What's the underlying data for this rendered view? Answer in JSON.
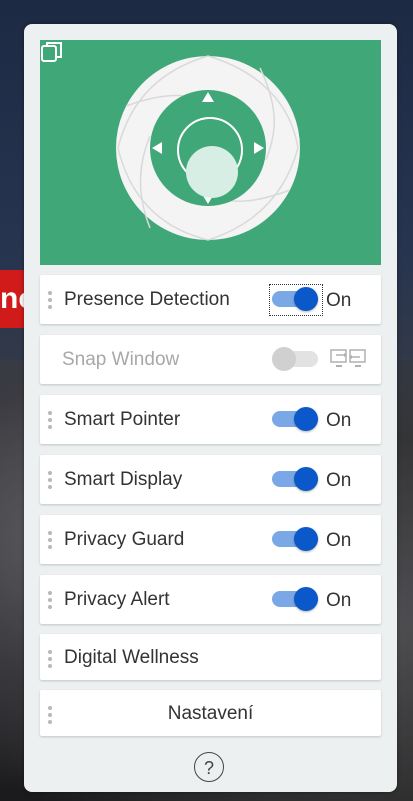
{
  "background": {
    "brand_fragment": "no"
  },
  "hero": {
    "accent_color": "#3fa778",
    "copy_icon": "copy-icon"
  },
  "items": [
    {
      "label": "Presence Detection",
      "state": "On",
      "enabled": true
    },
    {
      "label": "Snap Window",
      "state": "",
      "enabled": false,
      "icon": "dual-monitor-icon"
    },
    {
      "label": "Smart Pointer",
      "state": "On",
      "enabled": true
    },
    {
      "label": "Smart Display",
      "state": "On",
      "enabled": true
    },
    {
      "label": "Privacy Guard",
      "state": "On",
      "enabled": true
    },
    {
      "label": "Privacy Alert",
      "state": "On",
      "enabled": true
    },
    {
      "label": "Digital Wellness"
    },
    {
      "label": "Nastavení"
    }
  ],
  "help": {
    "symbol": "?"
  }
}
